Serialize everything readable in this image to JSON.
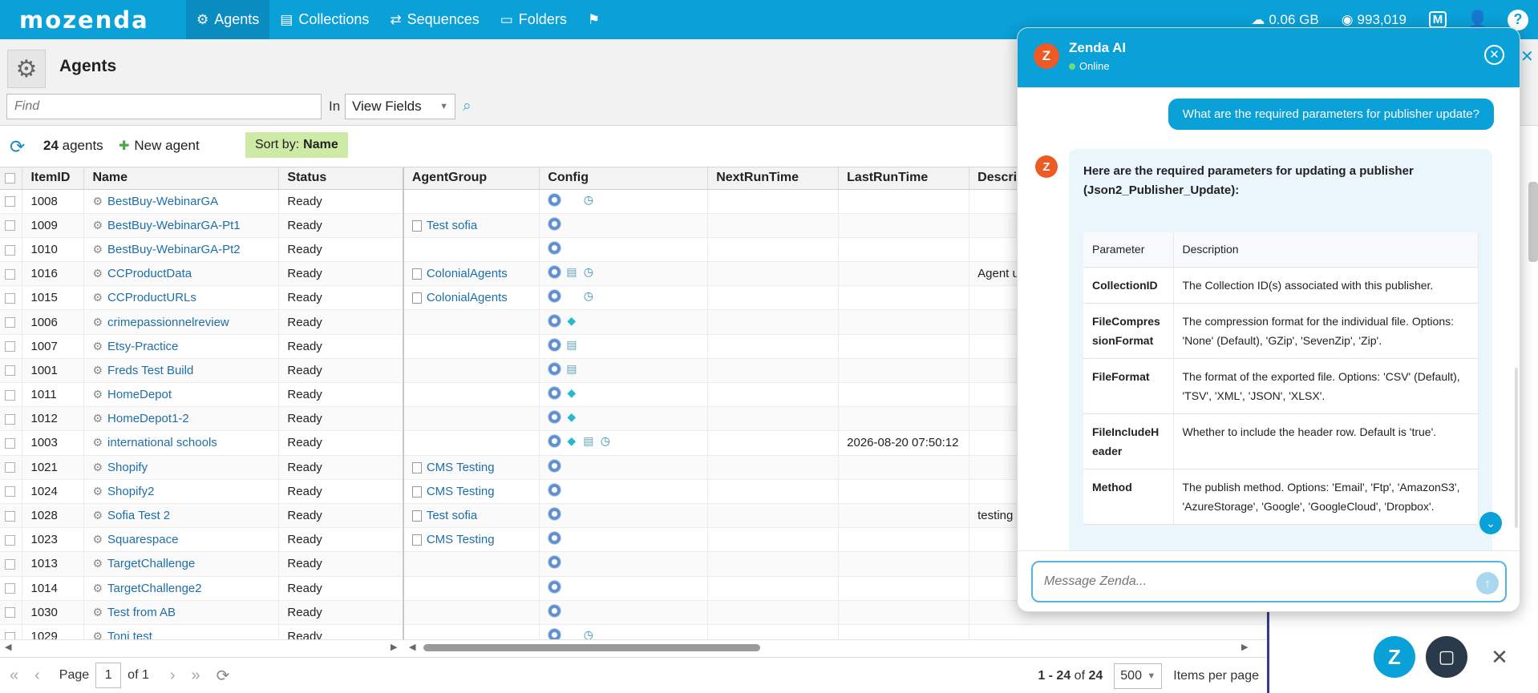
{
  "nav": {
    "logo": "mozenda",
    "items": [
      {
        "label": "Agents",
        "icon": "⚙"
      },
      {
        "label": "Collections",
        "icon": "🛢"
      },
      {
        "label": "Sequences",
        "icon": "⇄"
      },
      {
        "label": "Folders",
        "icon": "📂"
      }
    ],
    "storage": "0.06 GB",
    "credits": "993,019"
  },
  "page": {
    "title": "Agents",
    "find_placeholder": "Find",
    "in_label": "In",
    "view_select": "View Fields"
  },
  "toolbar": {
    "count": "24",
    "count_suffix": " agents",
    "new_agent": "New agent",
    "sort_label": "Sort by:",
    "sort_value": "Name"
  },
  "table": {
    "columns": [
      "ItemID",
      "Name",
      "Status",
      "AgentGroup",
      "Config",
      "NextRunTime",
      "LastRunTime",
      "Description"
    ],
    "rows": [
      {
        "id": "1008",
        "name": "BestBuy-WebinarGA",
        "status": "Ready",
        "group": "",
        "config": [
          "chrome",
          "",
          "clock"
        ],
        "next": "",
        "last": "",
        "desc": ""
      },
      {
        "id": "1009",
        "name": "BestBuy-WebinarGA-Pt1",
        "status": "Ready",
        "group": "Test sofia",
        "config": [
          "chrome"
        ],
        "next": "",
        "last": "",
        "desc": ""
      },
      {
        "id": "1010",
        "name": "BestBuy-WebinarGA-Pt2",
        "status": "Ready",
        "group": "",
        "config": [
          "chrome"
        ],
        "next": "",
        "last": "",
        "desc": ""
      },
      {
        "id": "1016",
        "name": "CCProductData",
        "status": "Ready",
        "group": "ColonialAgents",
        "config": [
          "chrome",
          "db",
          "clock"
        ],
        "next": "",
        "last": "",
        "desc": "Agent u"
      },
      {
        "id": "1015",
        "name": "CCProductURLs",
        "status": "Ready",
        "group": "ColonialAgents",
        "config": [
          "chrome",
          "",
          "clock"
        ],
        "next": "",
        "last": "",
        "desc": ""
      },
      {
        "id": "1006",
        "name": "crimepassionnelreview",
        "status": "Ready",
        "group": "",
        "config": [
          "chrome",
          "gem"
        ],
        "next": "",
        "last": "",
        "desc": ""
      },
      {
        "id": "1007",
        "name": "Etsy-Practice",
        "status": "Ready",
        "group": "",
        "config": [
          "chrome",
          "db"
        ],
        "next": "",
        "last": "",
        "desc": ""
      },
      {
        "id": "1001",
        "name": "Freds Test Build",
        "status": "Ready",
        "group": "",
        "config": [
          "chrome",
          "db"
        ],
        "next": "",
        "last": "",
        "desc": ""
      },
      {
        "id": "1011",
        "name": "HomeDepot",
        "status": "Ready",
        "group": "",
        "config": [
          "chrome",
          "gem"
        ],
        "next": "",
        "last": "",
        "desc": ""
      },
      {
        "id": "1012",
        "name": "HomeDepot1-2",
        "status": "Ready",
        "group": "",
        "config": [
          "chrome",
          "gem"
        ],
        "next": "",
        "last": "",
        "desc": ""
      },
      {
        "id": "1003",
        "name": "international schools",
        "status": "Ready",
        "group": "",
        "config": [
          "chrome",
          "gem",
          "db",
          "clock"
        ],
        "next": "",
        "last": "2026-08-20 07:50:12",
        "desc": ""
      },
      {
        "id": "1021",
        "name": "Shopify",
        "status": "Ready",
        "group": "CMS Testing",
        "config": [
          "chrome"
        ],
        "next": "",
        "last": "",
        "desc": ""
      },
      {
        "id": "1024",
        "name": "Shopify2",
        "status": "Ready",
        "group": "CMS Testing",
        "config": [
          "chrome"
        ],
        "next": "",
        "last": "",
        "desc": ""
      },
      {
        "id": "1028",
        "name": "Sofia Test 2",
        "status": "Ready",
        "group": "Test sofia",
        "config": [
          "chrome"
        ],
        "next": "",
        "last": "",
        "desc": "testing"
      },
      {
        "id": "1023",
        "name": "Squarespace",
        "status": "Ready",
        "group": "CMS Testing",
        "config": [
          "chrome"
        ],
        "next": "",
        "last": "",
        "desc": ""
      },
      {
        "id": "1013",
        "name": "TargetChallenge",
        "status": "Ready",
        "group": "",
        "config": [
          "chrome"
        ],
        "next": "",
        "last": "",
        "desc": ""
      },
      {
        "id": "1014",
        "name": "TargetChallenge2",
        "status": "Ready",
        "group": "",
        "config": [
          "chrome"
        ],
        "next": "",
        "last": "",
        "desc": ""
      },
      {
        "id": "1030",
        "name": "Test from AB",
        "status": "Ready",
        "group": "",
        "config": [
          "chrome"
        ],
        "next": "",
        "last": "",
        "desc": ""
      },
      {
        "id": "1029",
        "name": "Toni test",
        "status": "Ready",
        "group": "",
        "config": [
          "chrome",
          "",
          "clock"
        ],
        "next": "",
        "last": "",
        "desc": ""
      }
    ]
  },
  "pager": {
    "page_label": "Page",
    "page": "1",
    "of_label": "of 1",
    "range": "1 - 24",
    "of_word": " of ",
    "total": "24",
    "page_size": "500",
    "per_page_label": "Items per page"
  },
  "chat": {
    "name": "Zenda AI",
    "status": "Online",
    "avatar_letter": "Z",
    "user_message": "What are the required parameters for publisher update?",
    "bot_intro": "Here are the required parameters for updating a publisher (Json2_Publisher_Update):",
    "table_headers": [
      "Parameter",
      "Description"
    ],
    "params": [
      {
        "name": "CollectionID",
        "desc": "The Collection ID(s) associated with this publisher."
      },
      {
        "name": "FileCompressionFormat",
        "desc": "The compression format for the individual file. Options: 'None' (Default), 'GZip', 'SevenZip', 'Zip'."
      },
      {
        "name": "FileFormat",
        "desc": "The format of the exported file. Options: 'CSV' (Default), 'TSV', 'XML', 'JSON', 'XLSX'."
      },
      {
        "name": "FileIncludeHeader",
        "desc": "Whether to include the header row. Default is 'true'."
      },
      {
        "name": "Method",
        "desc": "The publish method. Options: 'Email', 'Ftp', 'AmazonS3', 'AzureStorage', 'Google', 'GoogleCloud', 'Dropbox'."
      }
    ],
    "input_placeholder": "Message Zenda..."
  },
  "colors": {
    "brand": "#0aa0d8",
    "avatar": "#ee5a24",
    "sort_badge": "#cfe9a6",
    "link": "#1f6ea8"
  }
}
